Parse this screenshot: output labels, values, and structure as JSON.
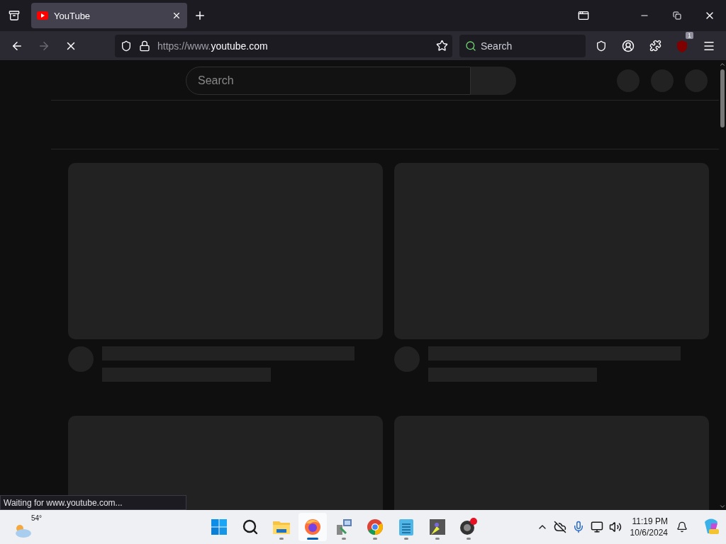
{
  "browser": {
    "tab": {
      "title": "YouTube",
      "selected": true
    },
    "nav": {
      "back_disabled": false,
      "forward_disabled": true,
      "loading": true
    },
    "address": {
      "prefix": "https://www.",
      "domain": "youtube.com"
    },
    "search": {
      "placeholder": "Search"
    },
    "extension_badge": "1",
    "status_text": "Waiting for www.youtube.com..."
  },
  "page": {
    "search": {
      "placeholder": "Search"
    },
    "loading": true
  },
  "taskbar": {
    "weather": {
      "temperature": "54°"
    },
    "apps": [
      {
        "kind": "start",
        "selected": false
      },
      {
        "kind": "search",
        "selected": false
      },
      {
        "kind": "folder",
        "selected": false
      },
      {
        "kind": "firefox",
        "selected": true
      },
      {
        "kind": "network",
        "selected": false
      },
      {
        "kind": "chrome",
        "selected": false
      },
      {
        "kind": "notepad",
        "selected": false
      },
      {
        "kind": "tool",
        "selected": false
      },
      {
        "kind": "obs",
        "selected": false
      }
    ],
    "time": "11:19 PM",
    "date": "10/6/2024"
  }
}
